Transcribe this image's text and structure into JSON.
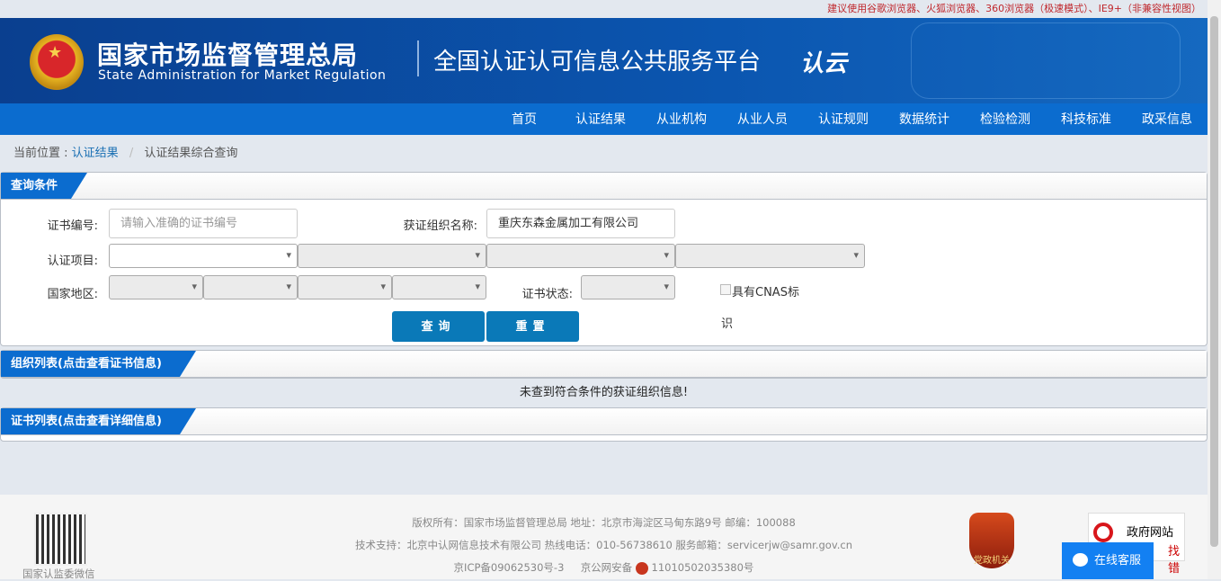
{
  "top_notice": "建议使用谷歌浏览器、火狐浏览器、360浏览器（极速模式）、IE9+（非兼容性视图）",
  "header": {
    "org_cn": "国家市场监督管理总局",
    "org_en": "State Administration  for  Market Regulation",
    "platform": "全国认证认可信息公共服务平台",
    "logo_text": "认云"
  },
  "nav": [
    "首页",
    "认证结果",
    "从业机构",
    "从业人员",
    "认证规则",
    "数据统计",
    "检验检测",
    "科技标准",
    "政采信息"
  ],
  "breadcrumb": {
    "prefix": "当前位置 :",
    "link": "认证结果",
    "sep": "/",
    "current": "认证结果综合查询"
  },
  "query": {
    "title": "查询条件",
    "cert_no_label": "证书编号:",
    "cert_no_placeholder": "请输入准确的证书编号",
    "org_label": "获证组织名称:",
    "org_value": "重庆东森金属加工有限公司",
    "project_label": "认证项目:",
    "region_label": "国家地区:",
    "status_label": "证书状态:",
    "cnas_label": "具有CNAS标",
    "cnas_label2": "识",
    "search_btn": "查询",
    "reset_btn": "重置"
  },
  "org_list": {
    "title": "组织列表(点击查看证书信息)",
    "empty_msg": "未查到符合条件的获证组织信息!"
  },
  "cert_list": {
    "title": "证书列表(点击查看详细信息)"
  },
  "footer": {
    "qr_label": "国家认监委微信",
    "line1": "版权所有：国家市场监督管理总局    地址：北京市海淀区马甸东路9号    邮编：100088",
    "line2": "技术支持：北京中认网信息技术有限公司    热线电话：010-56738610    服务邮箱：servicerjw@samr.gov.cn",
    "icp": "京ICP备09062530号-3",
    "police": "京公网安备",
    "police_no": "11010502035380号",
    "badge": "党政机关",
    "gov_site": "政府网站",
    "gov_site2": "找错",
    "chat": "在线客服"
  }
}
